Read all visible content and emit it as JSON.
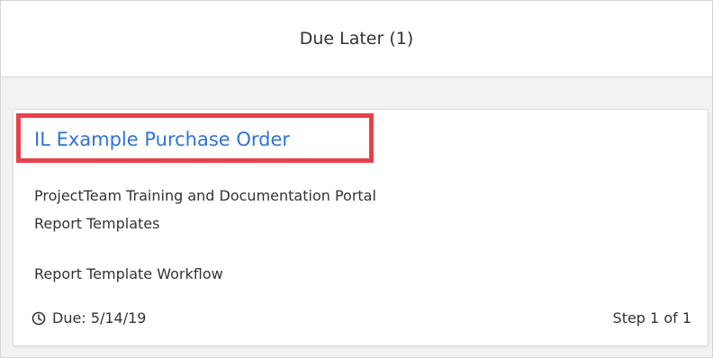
{
  "panel": {
    "title": "Due Later (1)"
  },
  "card": {
    "title": "IL Example Purchase Order",
    "project": "ProjectTeam Training and Documentation Portal",
    "folder": "Report Templates",
    "workflow": "Report Template Workflow",
    "due": "Due: 5/14/19",
    "step": "Step 1 of 1",
    "icon": "clock-icon"
  },
  "colors": {
    "link": "#2d74d6",
    "highlight": "#e8414b",
    "panel_background": "#f2f2f2",
    "text": "#333333"
  }
}
